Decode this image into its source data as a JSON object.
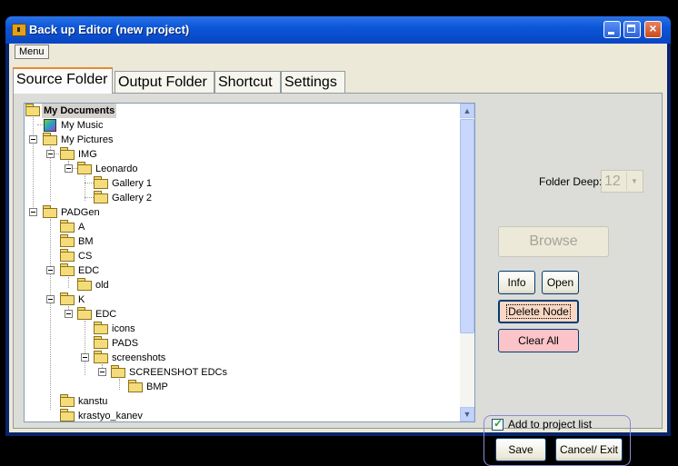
{
  "window": {
    "title": "Back up Editor  (new project)",
    "app_icon": "safe-icon",
    "buttons": [
      "minimize-icon",
      "maximize-icon",
      "close-icon"
    ]
  },
  "menu": {
    "items": [
      "Menu"
    ]
  },
  "tabs": [
    {
      "label": "Source Folder",
      "active": true
    },
    {
      "label": "Output Folder",
      "active": false
    },
    {
      "label": "Shortcut",
      "active": false
    },
    {
      "label": "Settings",
      "active": false
    }
  ],
  "tree": {
    "nodes": [
      {
        "label": "My Documents",
        "icon": "folder-icon",
        "level": 0,
        "selected": true
      },
      {
        "label": "My Music",
        "icon": "music-folder-icon",
        "level": 1
      },
      {
        "label": "My Pictures",
        "icon": "folder-icon",
        "level": 1,
        "expanded": true
      },
      {
        "label": "IMG",
        "icon": "folder-icon",
        "level": 2,
        "expanded": true
      },
      {
        "label": "Leonardo",
        "icon": "folder-icon",
        "level": 3,
        "expanded": true
      },
      {
        "label": "Gallery 1",
        "icon": "folder-icon",
        "level": 4
      },
      {
        "label": "Gallery 2",
        "icon": "folder-icon",
        "level": 4
      },
      {
        "label": "PADGen",
        "icon": "folder-icon",
        "level": 1,
        "expanded": true
      },
      {
        "label": "A",
        "icon": "folder-icon",
        "level": 2
      },
      {
        "label": "BM",
        "icon": "folder-icon",
        "level": 2
      },
      {
        "label": "CS",
        "icon": "folder-icon",
        "level": 2
      },
      {
        "label": "EDC",
        "icon": "folder-icon",
        "level": 2,
        "expanded": true
      },
      {
        "label": "old",
        "icon": "folder-icon",
        "level": 3
      },
      {
        "label": "K",
        "icon": "folder-icon",
        "level": 2,
        "expanded": true
      },
      {
        "label": "EDC",
        "icon": "folder-icon",
        "level": 3,
        "expanded": true
      },
      {
        "label": "icons",
        "icon": "folder-icon",
        "level": 4
      },
      {
        "label": "PADS",
        "icon": "folder-icon",
        "level": 4
      },
      {
        "label": "screenshots",
        "icon": "folder-icon",
        "level": 4,
        "expanded": true
      },
      {
        "label": "SCREENSHOT EDCs",
        "icon": "folder-icon",
        "level": 5,
        "expanded": true
      },
      {
        "label": "BMP",
        "icon": "folder-icon",
        "level": 6
      },
      {
        "label": "kanstu",
        "icon": "folder-icon",
        "level": 2
      },
      {
        "label": "krastyo_kanev",
        "icon": "folder-icon",
        "level": 2
      }
    ]
  },
  "settings": {
    "folder_deep_label": "Folder Deep:",
    "folder_deep_value": "12"
  },
  "buttons": {
    "browse": "Browse",
    "info": "Info",
    "open": "Open",
    "delete_node": "Delete Node",
    "clear_all": "Clear All",
    "save": "Save",
    "cancel_exit": "Cancel/ Exit"
  },
  "project": {
    "add_to_list_label": "Add to project list",
    "add_to_list_checked": true
  }
}
